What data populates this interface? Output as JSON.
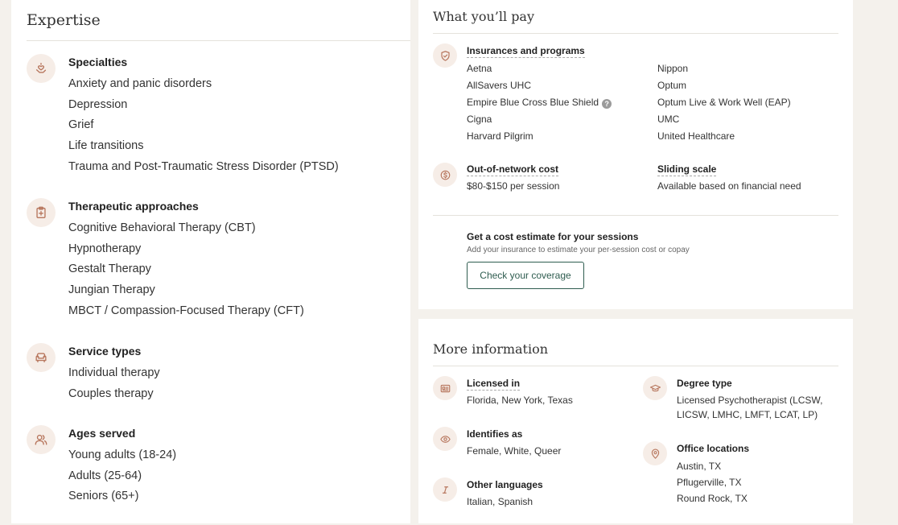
{
  "expertise": {
    "title": "Expertise",
    "groups": [
      {
        "title": "Specialties",
        "icon": "heart-hand-icon",
        "items": [
          "Anxiety and panic disorders",
          "Depression",
          "Grief",
          "Life transitions",
          "Trauma and Post-Traumatic Stress Disorder (PTSD)"
        ]
      },
      {
        "title": "Therapeutic approaches",
        "icon": "clipboard-plus-icon",
        "items": [
          "Cognitive Behavioral Therapy (CBT)",
          "Hypnotherapy",
          "Gestalt Therapy",
          "Jungian Therapy",
          "MBCT / Compassion-Focused Therapy (CFT)"
        ]
      },
      {
        "title": "Service types",
        "icon": "armchair-icon",
        "items": [
          "Individual therapy",
          "Couples therapy"
        ]
      },
      {
        "title": "Ages served",
        "icon": "users-icon",
        "items": [
          "Young adults (18-24)",
          "Adults (25-64)",
          "Seniors (65+)"
        ]
      }
    ]
  },
  "pay": {
    "title": "What you’ll pay",
    "insurance_heading": "Insurances and programs",
    "insurances_col1": [
      "Aetna",
      "AllSavers UHC",
      "Empire Blue Cross Blue Shield",
      "Cigna",
      "Harvard Pilgrim"
    ],
    "insurances_col2": [
      "Nippon",
      "Optum",
      "Optum Live & Work Well (EAP)",
      "UMC",
      "United Healthcare"
    ],
    "help_glyph": "?",
    "oon_heading": "Out-of-network cost",
    "oon_value": "$80-$150 per session",
    "sliding_heading": "Sliding scale",
    "sliding_value": "Available based on financial need",
    "estimate_heading": "Get a cost estimate for your sessions",
    "estimate_sub": "Add your insurance to estimate your per-session cost or copay",
    "coverage_button": "Check your coverage"
  },
  "more": {
    "title": "More information",
    "licensed_heading": "Licensed in",
    "licensed_value": "Florida, New York, Texas",
    "identifies_heading": "Identifies as",
    "identifies_value": "Female, White, Queer",
    "languages_heading": "Other languages",
    "languages_value": "Italian, Spanish",
    "degree_heading": "Degree type",
    "degree_line1": "Licensed Psychotherapist (LCSW,",
    "degree_line2": "LICSW, LMHC, LMFT, LCAT, LP)",
    "offices_heading": "Office locations",
    "offices": [
      "Austin, TX",
      "Pflugerville, TX",
      "Round Rock, TX"
    ]
  },
  "colors": {
    "icon_tint": "#b7765d",
    "icon_bg": "#f6ede7",
    "accent_green": "#2f5d50"
  }
}
